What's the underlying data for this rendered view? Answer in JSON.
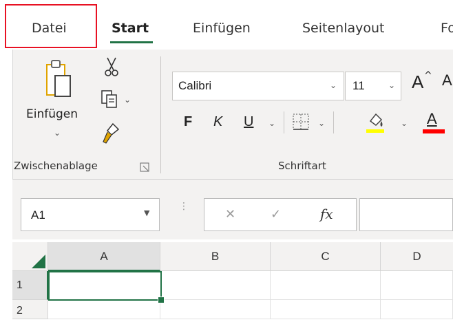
{
  "tabs": [
    {
      "label": "Datei"
    },
    {
      "label": "Start"
    },
    {
      "label": "Einfügen"
    },
    {
      "label": "Seitenlayout"
    },
    {
      "label": "Fo"
    }
  ],
  "clipboard": {
    "paste_label": "Einfügen",
    "group_label": "Zwischenablage"
  },
  "font": {
    "font_name": "Calibri",
    "font_size": "11",
    "grow_glyph": "A",
    "bold": "F",
    "italic": "K",
    "underline": "U",
    "font_color_glyph": "A",
    "group_label": "Schriftart"
  },
  "formula_bar": {
    "name_box": "A1",
    "cancel_glyph": "✕",
    "enter_glyph": "✓",
    "fx_label": "fx"
  },
  "sheet": {
    "columns": [
      "A",
      "B",
      "C",
      "D"
    ],
    "rows": [
      "1",
      "2"
    ],
    "selected_cell": "A1"
  },
  "colors": {
    "accent_green": "#217346",
    "highlight_red": "#e81123",
    "fill_yellow": "#ffff00",
    "font_red": "#ff0000"
  }
}
